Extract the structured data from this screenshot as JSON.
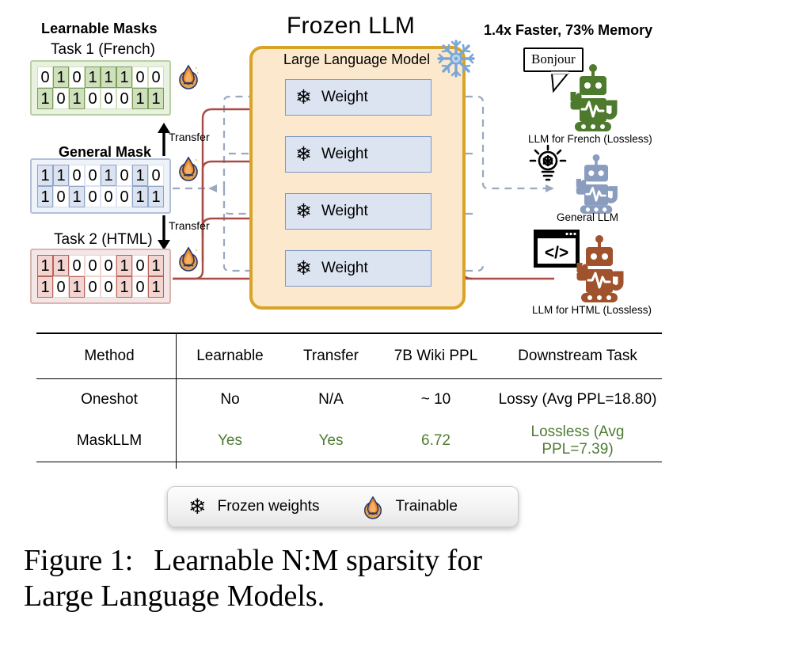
{
  "headings": {
    "learnable_masks": "Learnable Masks",
    "task1": "Task 1 (French)",
    "general_mask": "General Mask",
    "task2": "Task 2 (HTML)",
    "frozen_llm": "Frozen LLM",
    "speed_memory": "1.4x Faster, 73% Memory",
    "llm_inner": "Large Language Model"
  },
  "masks": {
    "task1": {
      "label": "Task 1 (French)",
      "color": "#7b9c5b",
      "rows": [
        [
          "0",
          "1",
          "0",
          "1",
          "1",
          "1",
          "0",
          "0"
        ],
        [
          "1",
          "0",
          "1",
          "0",
          "0",
          "0",
          "1",
          "1"
        ]
      ]
    },
    "general": {
      "label": "General Mask",
      "color": "#90a4c5",
      "rows": [
        [
          "1",
          "1",
          "0",
          "0",
          "1",
          "0",
          "1",
          "0"
        ],
        [
          "1",
          "0",
          "1",
          "0",
          "0",
          "0",
          "1",
          "1"
        ]
      ]
    },
    "task2": {
      "label": "Task 2 (HTML)",
      "color": "#b5645c",
      "rows": [
        [
          "1",
          "1",
          "0",
          "0",
          "0",
          "1",
          "0",
          "1"
        ],
        [
          "1",
          "0",
          "1",
          "0",
          "0",
          "1",
          "0",
          "1"
        ]
      ]
    }
  },
  "transfer": {
    "up_label": "Transfer",
    "down_label": "Transfer"
  },
  "llm": {
    "title": "Large Language Model",
    "weights": [
      {
        "label": "Weight"
      },
      {
        "label": "Weight"
      },
      {
        "label": "Weight"
      },
      {
        "label": "Weight"
      }
    ],
    "frozen_icon": "snowflake-icon",
    "box_color": "#d9a326",
    "weight_fill": "#dce4f2"
  },
  "outputs": [
    {
      "id": "french",
      "speech": "Bonjour",
      "label": "LLM for French (Lossless)",
      "icon": "speech-bubble-icon",
      "robot_color": "#4e7a2e"
    },
    {
      "id": "general",
      "speech": "",
      "label": "General LLM",
      "icon": "lightbulb-icon",
      "robot_color": "#8b9dbe"
    },
    {
      "id": "html",
      "speech": "</>",
      "label": "LLM for HTML (Lossless)",
      "icon": "code-window-icon",
      "robot_color": "#a0522d"
    }
  ],
  "table": {
    "headers": [
      "Method",
      "Learnable",
      "Transfer",
      "7B Wiki PPL",
      "Downstream Task"
    ],
    "rows": [
      {
        "cells": [
          "Oneshot",
          "No",
          "N/A",
          "~ 10",
          "Lossy (Avg PPL=18.80)"
        ],
        "highlight": false
      },
      {
        "cells": [
          "MaskLLM",
          "Yes",
          "Yes",
          "6.72",
          "Lossless (Avg PPL=7.39)"
        ],
        "highlight": true
      }
    ],
    "highlight_color": "#4f7c34"
  },
  "legend": {
    "frozen_label": "Frozen weights",
    "trainable_label": "Trainable",
    "frozen_icon": "snowflake-icon",
    "trainable_icon": "flame-icon"
  },
  "caption": {
    "line1_prefix": "Figure 1:",
    "line1_rest": "Learnable N:M sparsity for",
    "line2": "Large Language Models."
  }
}
